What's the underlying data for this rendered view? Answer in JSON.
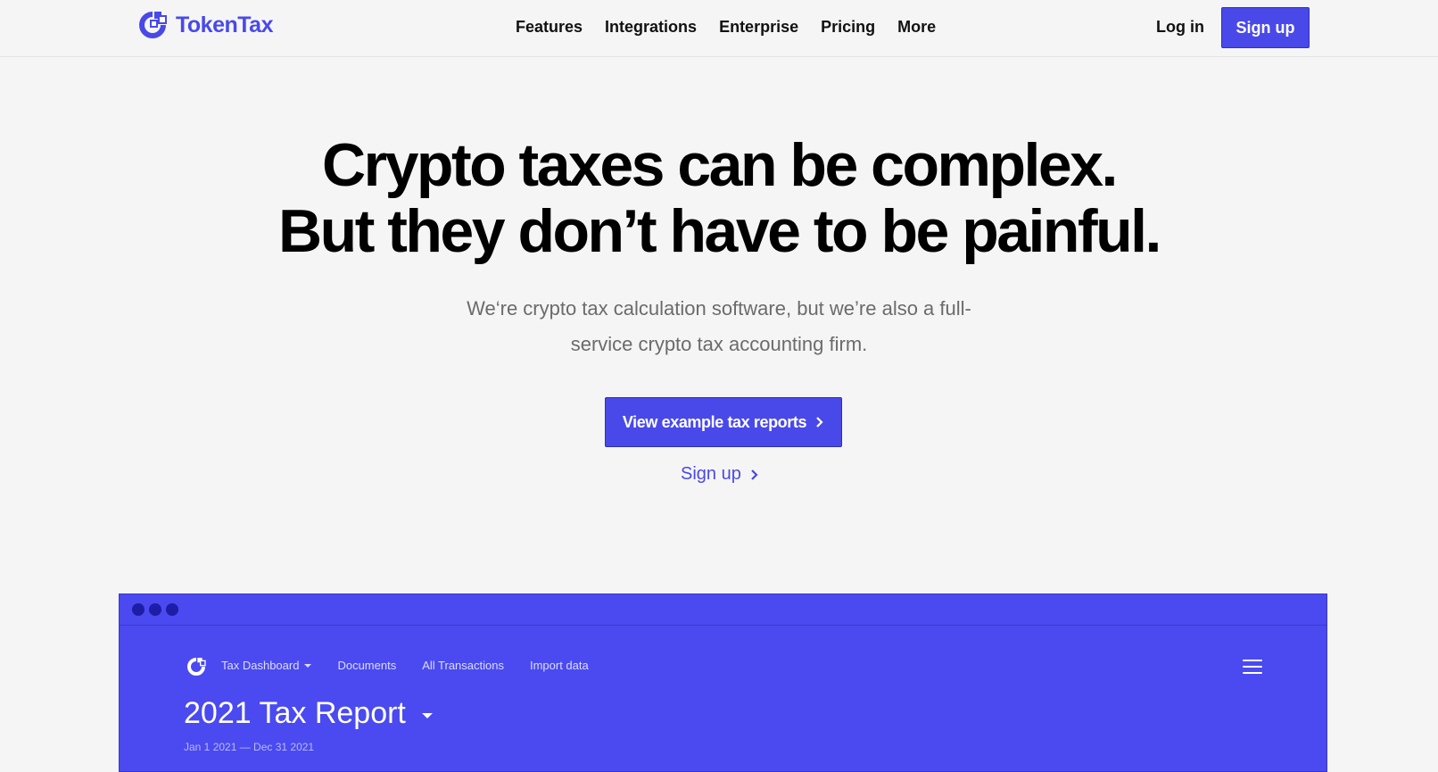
{
  "header": {
    "logo_text": "TokenTax",
    "nav": [
      {
        "label": "Features"
      },
      {
        "label": "Integrations"
      },
      {
        "label": "Enterprise"
      },
      {
        "label": "Pricing"
      },
      {
        "label": "More"
      }
    ],
    "login_label": "Log in",
    "signup_label": "Sign up"
  },
  "hero": {
    "title_line1": "Crypto taxes can be complex.",
    "title_line2": "But they don’t have to be painful.",
    "subtitle": "We‘re crypto tax calculation software, but we’re also a full-service crypto tax accounting firm.",
    "cta_label": "View example tax reports",
    "signup_link": "Sign up"
  },
  "app_preview": {
    "nav": [
      {
        "label": "Tax Dashboard"
      },
      {
        "label": "Documents"
      },
      {
        "label": "All Transactions"
      },
      {
        "label": "Import data"
      }
    ],
    "report_title": "2021 Tax Report",
    "report_dates": "Jan 1 2021 — Dec 31 2021"
  },
  "colors": {
    "brand": "#4949ea",
    "background": "#f5f5f5",
    "text": "#000000",
    "muted_text": "#6b6b6b"
  },
  "icons": {
    "logo": "tokentax-logo-icon",
    "chevron": "chevron-right-icon",
    "menu": "hamburger-menu-icon",
    "dropdown": "caret-down-icon"
  }
}
